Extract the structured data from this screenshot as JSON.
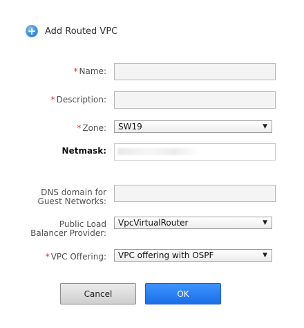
{
  "dialog": {
    "title": "Add Routed VPC",
    "title_icon": "plus-circle-icon",
    "accent": "#2f86e6"
  },
  "fields": {
    "name": {
      "label": "Name:",
      "value": "",
      "required": true
    },
    "description": {
      "label": "Description:",
      "value": "",
      "required": true
    },
    "zone": {
      "label": "Zone:",
      "selected": "SW19",
      "required": true
    },
    "netmask": {
      "label": "Netmask:",
      "value": ""
    },
    "dns_domain": {
      "label_line1": "DNS domain for",
      "label_line2": "Guest Networks:",
      "value": ""
    },
    "public_lb": {
      "label_line1": "Public Load",
      "label_line2": "Balancer Provider:",
      "selected": "VpcVirtualRouter"
    },
    "vpc_offering": {
      "label": "VPC Offering:",
      "selected": "VPC offering with OSPF",
      "required": true
    }
  },
  "required_marker": "*",
  "caret": "▼",
  "buttons": {
    "cancel": "Cancel",
    "ok": "OK"
  }
}
